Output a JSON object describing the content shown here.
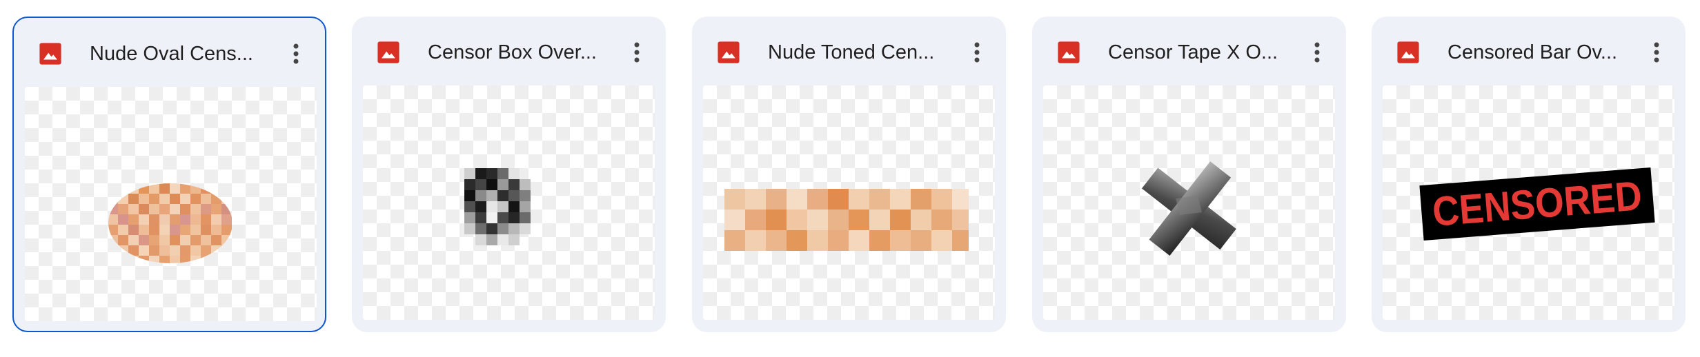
{
  "files": [
    {
      "name": "Nude Oval Cens...",
      "icon": "image-file-icon",
      "selected": true
    },
    {
      "name": "Censor Box Over...",
      "icon": "image-file-icon",
      "selected": false
    },
    {
      "name": "Nude Toned Cen...",
      "icon": "image-file-icon",
      "selected": false
    },
    {
      "name": "Censor Tape X O...",
      "icon": "image-file-icon",
      "selected": false
    },
    {
      "name": "Censored Bar Ov...",
      "icon": "image-file-icon",
      "selected": false
    }
  ],
  "thumbnails": {
    "censored_text": "CENSORED"
  },
  "colors": {
    "card_bg": "#eef2f8",
    "selected_border": "#0b57d0",
    "image_icon": "#d93025",
    "censored_red": "#e53935"
  }
}
